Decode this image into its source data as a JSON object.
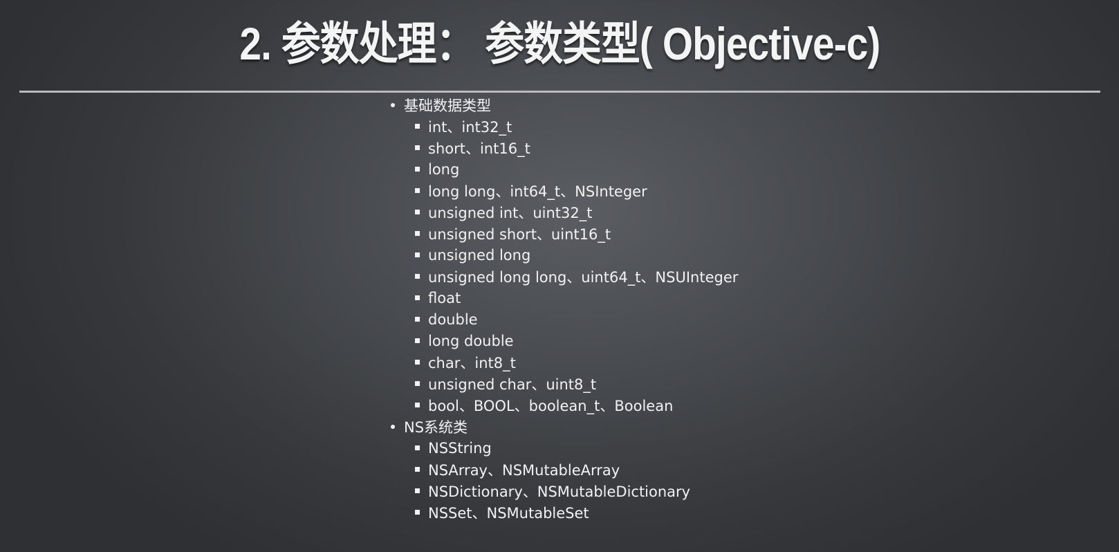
{
  "slide": {
    "title": "2. 参数处理： 参数类型( Objective-c)",
    "sections": [
      {
        "label": "基础数据类型",
        "items": [
          "int、int32_t",
          "short、int16_t",
          "long",
          "long long、int64_t、NSInteger",
          "unsigned int、uint32_t",
          "unsigned short、uint16_t",
          "unsigned long",
          "unsigned long long、uint64_t、NSUInteger",
          "float",
          "double",
          "long double",
          "char、int8_t",
          "unsigned char、uint8_t",
          "bool、BOOL、boolean_t、Boolean"
        ]
      },
      {
        "label": "NS系统类",
        "items": [
          "NSString",
          "NSArray、NSMutableArray",
          "NSDictionary、NSMutableDictionary",
          "NSSet、NSMutableSet"
        ]
      }
    ]
  }
}
